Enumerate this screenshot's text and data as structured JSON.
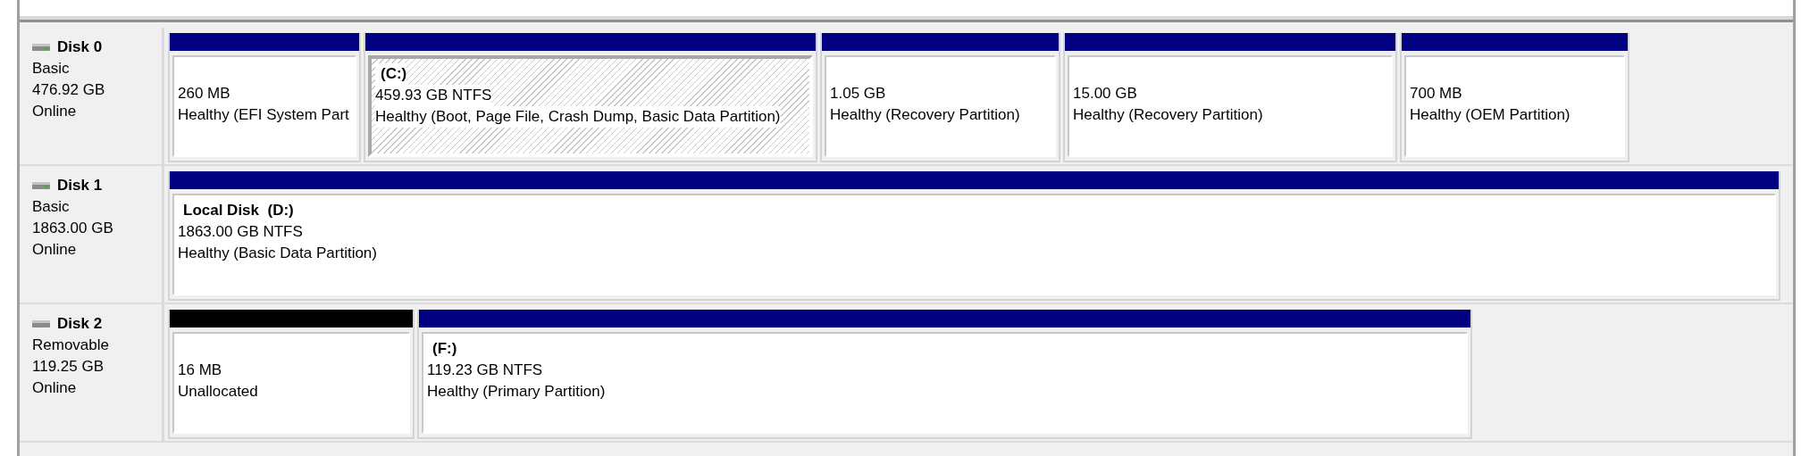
{
  "disks": [
    {
      "name": "Disk 0",
      "kind": "fixed",
      "type": "Basic",
      "size": "476.92 GB",
      "status": "Online",
      "partitions": [
        {
          "kind": "primary",
          "selected": false,
          "size": "260 MB",
          "status": "Healthy (EFI System Part"
        },
        {
          "kind": "primary",
          "selected": true,
          "label": "(C:)",
          "size": "459.93 GB NTFS",
          "status": "Healthy (Boot, Page File, Crash Dump, Basic Data Partition)"
        },
        {
          "kind": "primary",
          "selected": false,
          "size": "1.05 GB",
          "status": "Healthy (Recovery Partition)"
        },
        {
          "kind": "primary",
          "selected": false,
          "size": "15.00 GB",
          "status": "Healthy (Recovery Partition)"
        },
        {
          "kind": "primary",
          "selected": false,
          "size": "700 MB",
          "status": "Healthy (OEM Partition)"
        }
      ]
    },
    {
      "name": "Disk 1",
      "kind": "fixed",
      "type": "Basic",
      "size": "1863.00 GB",
      "status": "Online",
      "partitions": [
        {
          "kind": "primary",
          "selected": false,
          "label": "Local Disk  (D:)",
          "size": "1863.00 GB NTFS",
          "status": "Healthy (Basic Data Partition)"
        }
      ]
    },
    {
      "name": "Disk 2",
      "kind": "removable",
      "type": "Removable",
      "size": "119.25 GB",
      "status": "Online",
      "partitions": [
        {
          "kind": "unallocated",
          "selected": false,
          "size": "16 MB",
          "status": "Unallocated"
        },
        {
          "kind": "primary",
          "selected": false,
          "label": "(F:)",
          "size": "119.23 GB NTFS",
          "status": "Healthy (Primary Partition)"
        }
      ]
    }
  ]
}
